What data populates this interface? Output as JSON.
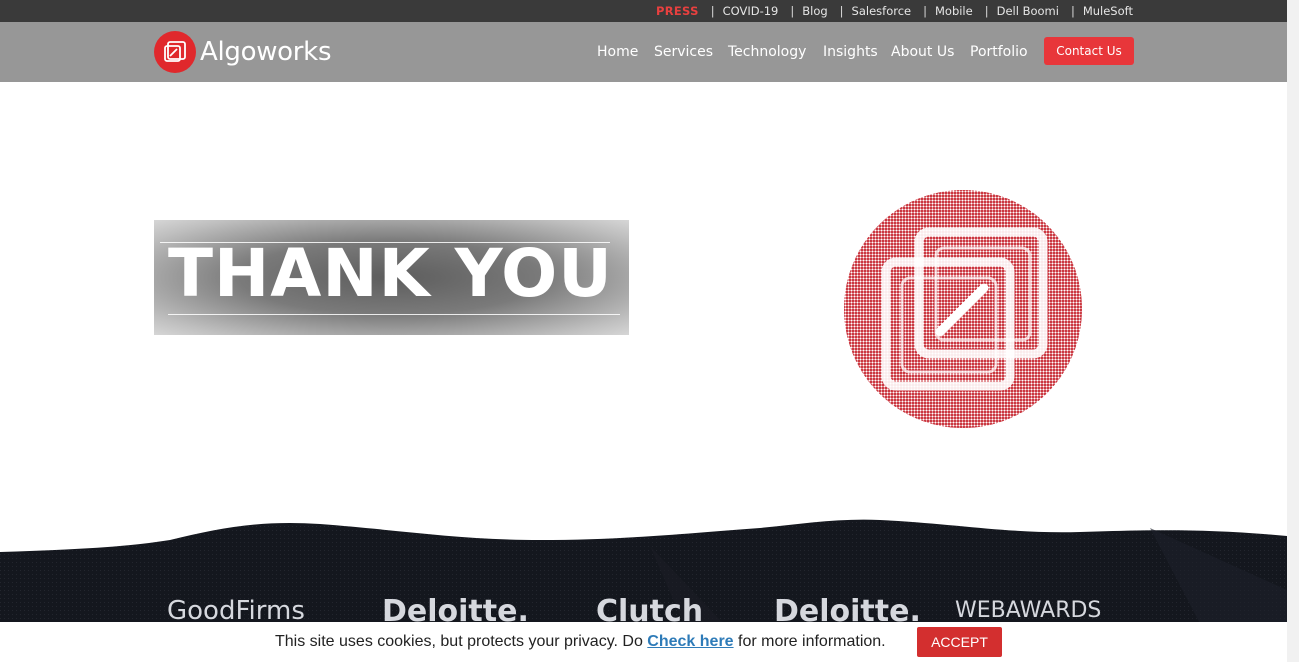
{
  "topbar": {
    "press": "PRESS",
    "links": [
      "COVID-19",
      "Blog",
      "Salesforce",
      "Mobile",
      "Dell Boomi",
      "MuleSoft"
    ],
    "separator": "|"
  },
  "header": {
    "logo_text": "Algoworks",
    "nav": [
      "Home",
      "Services",
      "Technology",
      "Insights",
      "About Us",
      "Portfolio"
    ],
    "contact_label": "Contact Us"
  },
  "hero": {
    "thanks_text": "THANK YOU",
    "logo_icon": "algoworks-mark-icon"
  },
  "awards": [
    "GoodFirms",
    "Deloitte.",
    "Clutch",
    "Deloitte.",
    "WEBAWARDS"
  ],
  "cookie": {
    "text_before": "This site uses cookies, but protects your privacy. Do ",
    "link_text": "Check here",
    "text_after": " for more information.",
    "accept_label": "ACCEPT"
  },
  "colors": {
    "brand_red": "#e0282c",
    "topbar": "#3a3a3a",
    "header": "#979797",
    "footer_dark": "#15181f",
    "link_blue": "#2e7bb8"
  }
}
